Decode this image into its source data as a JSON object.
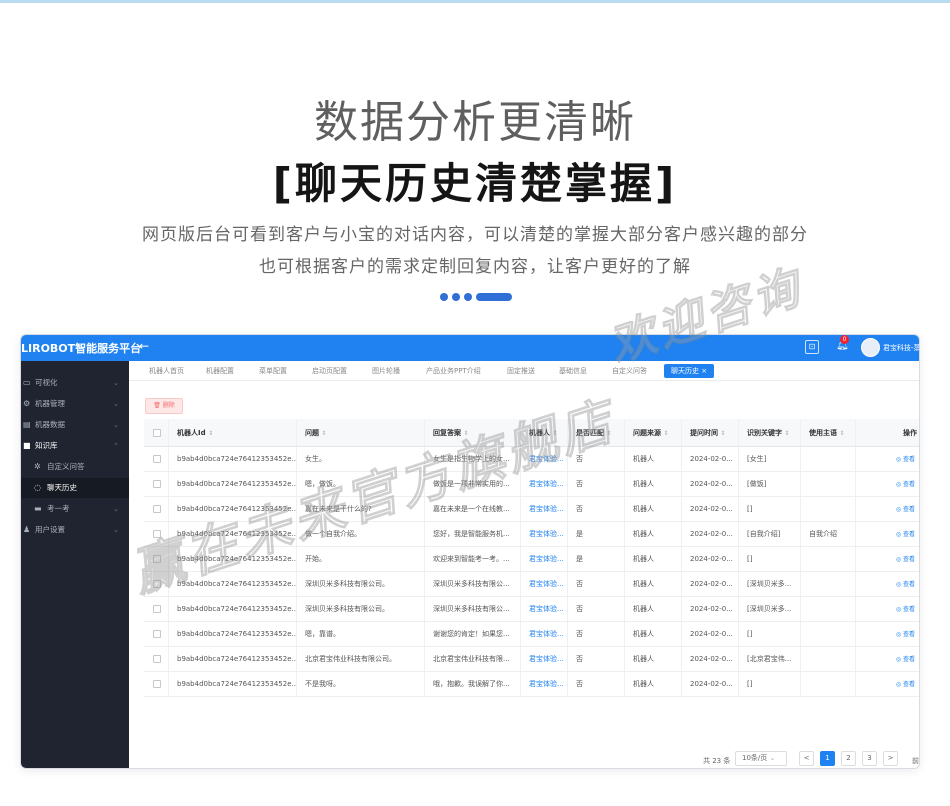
{
  "hero": {
    "subtitle": "数据分析更清晰",
    "title": "[聊天历史清楚掌握]",
    "desc1": "网页版后台可看到客户与小宝的对话内容，可以清楚的掌握大部分客户感兴趣的部分",
    "desc2": "也可根据客户的需求定制回复内容，让客户更好的了解"
  },
  "app": {
    "brand": "LIROBOT智能服务平台",
    "back_icon": "←",
    "notif_count": "0",
    "user_name": "君宝科技-蒸"
  },
  "sidebar": {
    "items": [
      {
        "label": "可视化",
        "icon": "monitor-icon"
      },
      {
        "label": "机器管理",
        "icon": "gear-icon"
      },
      {
        "label": "机器数据",
        "icon": "data-icon"
      },
      {
        "label": "知识库",
        "icon": "book-icon"
      },
      {
        "label": "自定义问答",
        "icon": "settings-icon"
      },
      {
        "label": "聊天历史",
        "icon": "chat-icon"
      },
      {
        "label": "考一考",
        "icon": "quiz-icon"
      },
      {
        "label": "用户设置",
        "icon": "user-icon"
      }
    ]
  },
  "tabs": [
    "机器人首页",
    "机器配置",
    "菜单配置",
    "启动页配置",
    "图片轮播",
    "产品业务PPT介绍",
    "固定推送",
    "基础信息",
    "自定义问答",
    "聊天历史"
  ],
  "toolbar": {
    "delete_label": "删除"
  },
  "table": {
    "headers": [
      "机器人Id",
      "问题",
      "回复答案",
      "机器人",
      "是否匹配",
      "问题来源",
      "提问时间",
      "识别关键字",
      "使用主语",
      "操作"
    ],
    "rows": [
      [
        "b9ab4d0bca724e76412353452e...",
        "女生。",
        "女生是指生物学上的女...",
        "君宝体验...",
        "否",
        "机器人",
        "2024-02-0...",
        "[女生]",
        ""
      ],
      [
        "b9ab4d0bca724e76412353452e...",
        "嗯，做饭。",
        "做饭是一项非常实用的...",
        "君宝体验...",
        "否",
        "机器人",
        "2024-02-0...",
        "[做饭]",
        ""
      ],
      [
        "b9ab4d0bca724e76412353452e...",
        "嘉在未来是干什么的?",
        "嘉在未来是一个在线教...",
        "君宝体验...",
        "否",
        "机器人",
        "2024-02-0...",
        "[]",
        ""
      ],
      [
        "b9ab4d0bca724e76412353452e...",
        "做一个自我介绍。",
        "您好，我是智能服务机...",
        "君宝体验...",
        "是",
        "机器人",
        "2024-02-0...",
        "[自我介绍]",
        "自我介绍"
      ],
      [
        "b9ab4d0bca724e76412353452e...",
        "开始。",
        "欢迎来到智能考一考。...",
        "君宝体验...",
        "是",
        "机器人",
        "2024-02-0...",
        "[]",
        ""
      ],
      [
        "b9ab4d0bca724e76412353452e...",
        "深圳贝米多科技有限公司。",
        "深圳贝米多科技有限公...",
        "君宝体验...",
        "否",
        "机器人",
        "2024-02-0...",
        "[深圳贝米多...",
        ""
      ],
      [
        "b9ab4d0bca724e76412353452e...",
        "深圳贝米多科技有限公司。",
        "深圳贝米多科技有限公...",
        "君宝体验...",
        "否",
        "机器人",
        "2024-02-0...",
        "[深圳贝米多...",
        ""
      ],
      [
        "b9ab4d0bca724e76412353452e...",
        "嗯，靠谱。",
        "谢谢您的肯定！如果您...",
        "君宝体验...",
        "否",
        "机器人",
        "2024-02-0...",
        "[]",
        ""
      ],
      [
        "b9ab4d0bca724e76412353452e...",
        "北京君宝伟业科技有限公司。",
        "北京君宝伟业科技有限...",
        "君宝体验...",
        "否",
        "机器人",
        "2024-02-0...",
        "[北京君宝伟...",
        ""
      ],
      [
        "b9ab4d0bca724e76412353452e...",
        "不是我呀。",
        "哦，抱歉。我误解了你...",
        "君宝体验...",
        "否",
        "机器人",
        "2024-02-0...",
        "[]",
        ""
      ]
    ],
    "op_view": "◎ 查看",
    "sort_glyph": "⇕"
  },
  "pagination": {
    "total": "共 23 条",
    "page_size": "10条/页",
    "pages": [
      "1",
      "2",
      "3"
    ],
    "current": "1",
    "prev": "<",
    "next": ">",
    "jump": "前"
  },
  "watermarks": [
    "赢在未来官方旗舰店",
    "欢迎咨询"
  ]
}
